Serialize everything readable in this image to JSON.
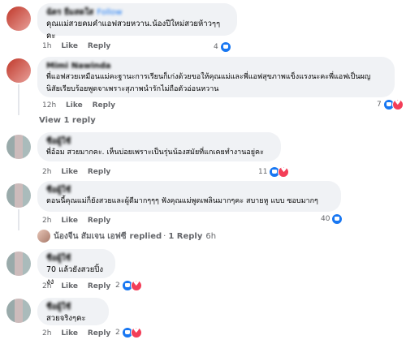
{
  "comments": [
    {
      "name": "ฉัตร ยิ้มสดใส",
      "follow": "Follow",
      "text": "คุณแม่สวยคมคำแอฟสวยหวาน.น้องปีใหม่สวยห้าวๆๆคะ",
      "time": "1h",
      "like": "Like",
      "reply": "Reply",
      "reactions": "4"
    },
    {
      "name": "Mimi Nawinda",
      "text_lines": [
        "พี่แอฟสวยเหมือนแม่คะฐานะการเรียนก็เก่งด้วยขอให้คุณแม่และพี่แอฟสุขภาพแข็งแรงนะคะพี่แอฟเป็นผญ",
        "นิสัยเรียบร้อยพูดจาเพราะสุภาพนำรักไม่ถือตัวอ่อนหวาน"
      ],
      "time": "12h",
      "like": "Like",
      "reply": "Reply",
      "reactions": "7"
    },
    {
      "name": "ชื่อผู้ใช้",
      "text": "พี่อ้อม สวยมากคะ. เห็นบ่อยเพราะเป็นรุ่นน้องสมัยที่แกเคยทำงานอยู่คะ",
      "time": "2h",
      "like": "Like",
      "reply": "Reply",
      "reactions": "11"
    },
    {
      "name": "ชื่อผู้ใช้",
      "text": "ตอนนี้คุณแม่ก็ยังสวยและผู้ดีมากๆๆๆ ฟังคุณแม่พูดเพลินมากๆคะ สบายหู แบบ ซอบมากๆ",
      "time": "2h",
      "like": "Like",
      "reply": "Reply",
      "reactions": "40"
    },
    {
      "name": "ชื่อผู้ใช้",
      "text": "70 แล้วยังสวยปิ้งงง",
      "time": "2h",
      "like": "Like",
      "reply": "Reply",
      "reactions": "2"
    },
    {
      "name": "ชื่อผู้ใช้",
      "text": "สวยจริงๆคะ",
      "time": "2h",
      "like": "Like",
      "reply": "Reply",
      "reactions": "2"
    }
  ],
  "view_replies": "View 1 reply",
  "reply_summary": {
    "name": "น้องจีน สัมเจน เอฟซี",
    "replied": "replied",
    "count": "1 Reply",
    "time": "6h"
  }
}
